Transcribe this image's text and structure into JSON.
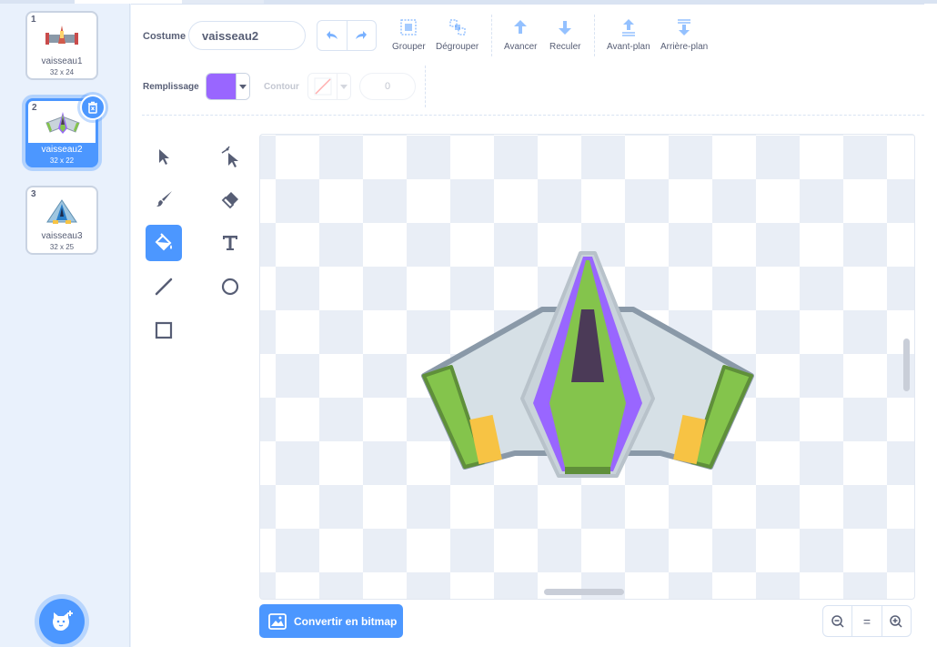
{
  "costumes": [
    {
      "index": "1",
      "name": "vaisseau1",
      "size": "32 x 24",
      "selected": false
    },
    {
      "index": "2",
      "name": "vaisseau2",
      "size": "32 x 22",
      "selected": true
    },
    {
      "index": "3",
      "name": "vaisseau3",
      "size": "32 x 25",
      "selected": false
    }
  ],
  "toolbar": {
    "costume_label": "Costume",
    "costume_name": "vaisseau2",
    "group_label": "Grouper",
    "ungroup_label": "Dégrouper",
    "forward_label": "Avancer",
    "backward_label": "Reculer",
    "front_label": "Avant-plan",
    "back_label": "Arrière-plan"
  },
  "fill": {
    "label": "Remplissage",
    "color": "#9966ff"
  },
  "outline": {
    "label": "Contour",
    "width": "0"
  },
  "tools": [
    "select-tool",
    "reshape-tool",
    "brush-tool",
    "eraser-tool",
    "fill-tool",
    "text-tool",
    "line-tool",
    "circle-tool",
    "rectangle-tool"
  ],
  "active_tool": "fill-tool",
  "convert_button": "Convertir en bitmap",
  "zoom": {
    "out": "zoom-out-icon",
    "reset": "=",
    "in": "zoom-in-icon"
  },
  "colors": {
    "accent": "#4c97ff",
    "ship_green": "#84c44c",
    "ship_purple": "#9966ff",
    "ship_yellow": "#f7c344"
  }
}
